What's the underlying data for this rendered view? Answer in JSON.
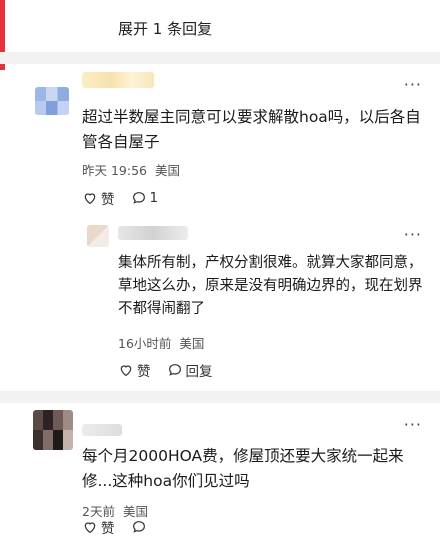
{
  "header": {
    "expand_label": "展开 1 条回复"
  },
  "comments": [
    {
      "text": "超过半数屋主同意可以要求解散hoa吗，以后各自管各自屋子",
      "time": "昨天 19:56",
      "location": "美国",
      "like_label": "赞",
      "reply_count": "1",
      "more_icon": "more-icon"
    },
    {
      "text": "集体所有制，产权分割很难。就算大家都同意，草地这么办，原来是没有明确边界的，现在划界不都得闹翻了",
      "time": "16小时前",
      "location": "美国",
      "like_label": "赞",
      "reply_label": "回复",
      "more_icon": "more-icon"
    },
    {
      "text": "每个月2000HOA费，修屋顶还要大家统一起来修...这种hoa你们见过吗",
      "time": "2天前",
      "location": "美国",
      "like_label": "赞",
      "reply_count": "",
      "more_icon": "more-icon"
    }
  ],
  "colors": {
    "accent": "#e5333d",
    "separator": "#f2f2f2",
    "meta": "#555555"
  }
}
